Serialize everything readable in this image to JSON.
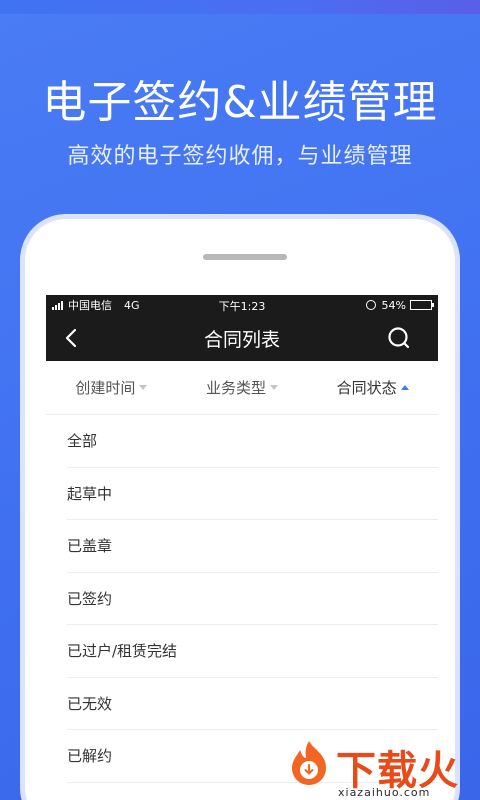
{
  "promo": {
    "headline": "电子签约&业绩管理",
    "subline": "高效的电子签约收佣，与业绩管理"
  },
  "status_bar": {
    "carrier": "中国电信",
    "network": "4G",
    "time": "下午1:23",
    "battery": "54%",
    "battery_level": 0.54
  },
  "nav": {
    "title": "合同列表",
    "back_icon": "chevron-left-icon",
    "search_icon": "search-icon"
  },
  "filters": [
    {
      "label": "创建时间",
      "state": "collapsed"
    },
    {
      "label": "业务类型",
      "state": "collapsed"
    },
    {
      "label": "合同状态",
      "state": "expanded"
    }
  ],
  "status_options": [
    "全部",
    "起草中",
    "已盖章",
    "已签约",
    "已过户/租赁完结",
    "已无效",
    "已解约"
  ],
  "watermark": {
    "brand": "下载火",
    "url": "xiazaihuo.com"
  },
  "colors": {
    "background": "#4a7cf5",
    "nav_bar": "#1b1b1b",
    "accent": "#3b7cf2",
    "watermark": "#e94a1a"
  }
}
